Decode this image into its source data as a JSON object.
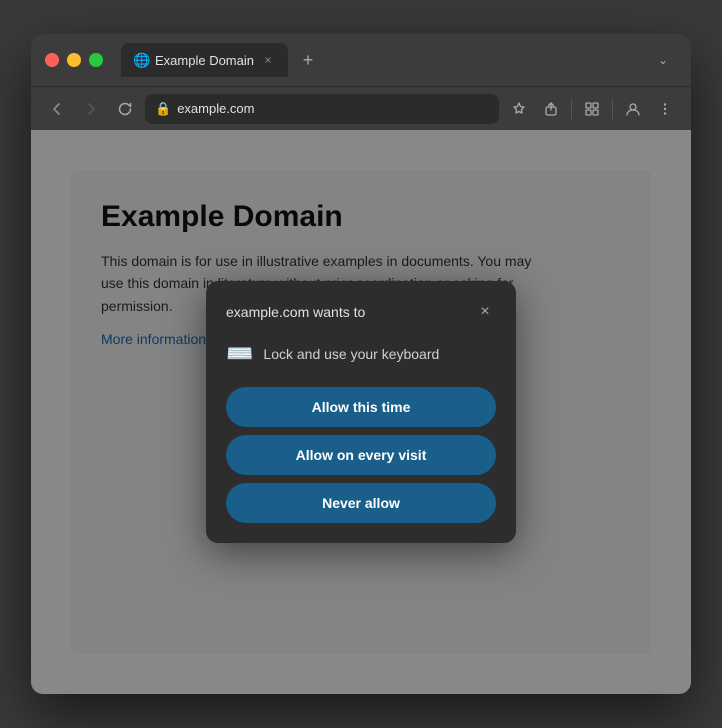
{
  "window": {
    "title": "Example Domain",
    "tab_label": "Example Domain",
    "address": "example.com"
  },
  "traffic_lights": {
    "red_label": "close",
    "yellow_label": "minimize",
    "green_label": "maximize"
  },
  "tab": {
    "title": "Example Domain",
    "close_symbol": "×",
    "new_symbol": "+"
  },
  "toolbar": {
    "back_symbol": "‹",
    "forward_symbol": "›",
    "reload_symbol": "↻",
    "dropdown_symbol": "⌄"
  },
  "page": {
    "heading": "Example Domain",
    "body": "This domain is for use in illustrative examples in documents. You may use this domain in literature without prior coordination or asking for permission.",
    "link_text": "More information..."
  },
  "dialog": {
    "title": "example.com wants to",
    "close_symbol": "×",
    "icon_text": "Lock and use your keyboard",
    "btn_allow_this_time": "Allow this time",
    "btn_allow_every_visit": "Allow on every visit",
    "btn_never_allow": "Never allow"
  }
}
